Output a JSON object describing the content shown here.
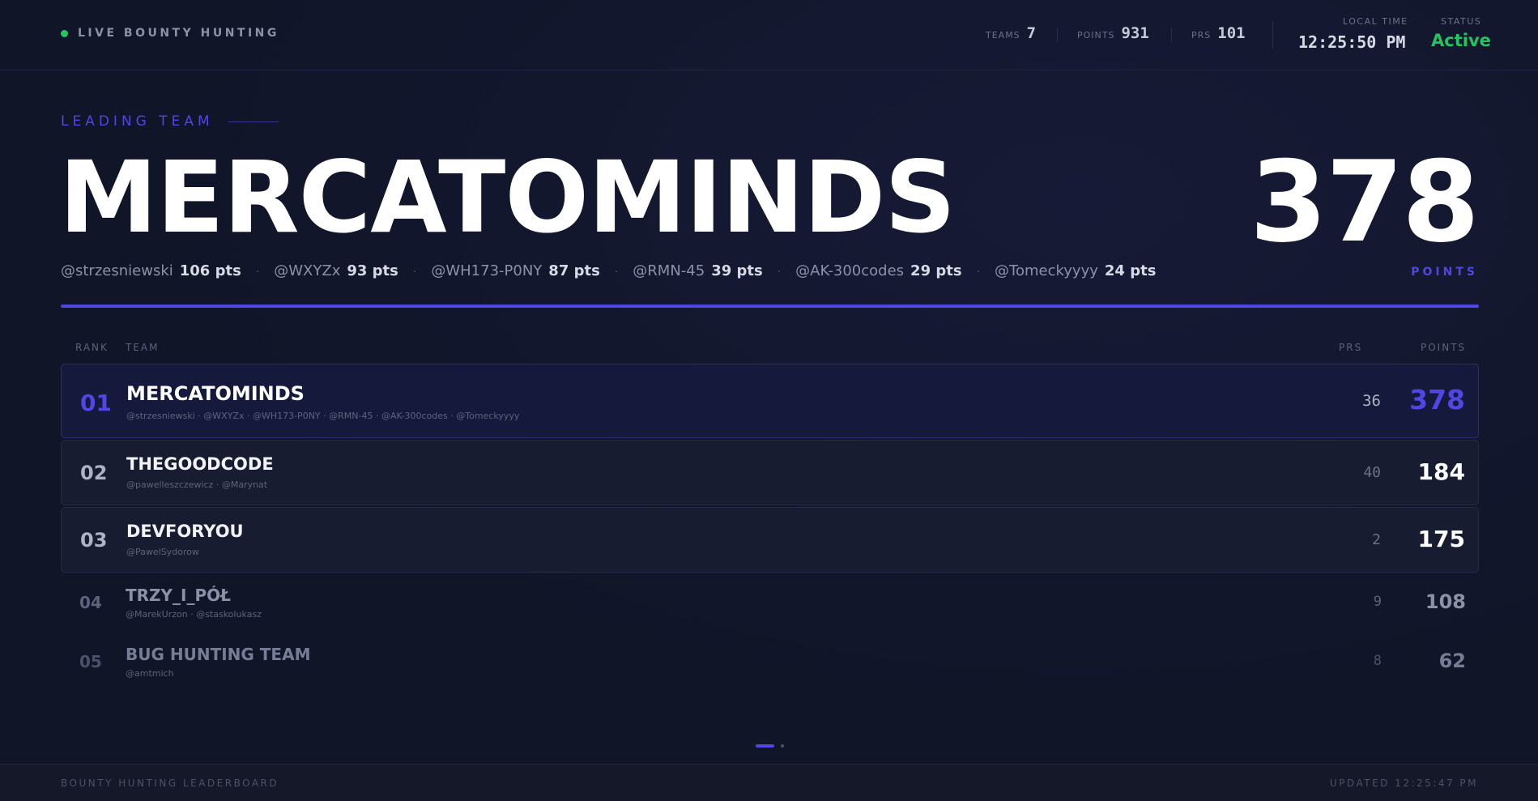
{
  "header": {
    "brand": "LIVE BOUNTY HUNTING",
    "stats": [
      {
        "label": "TEAMS",
        "value": "7"
      },
      {
        "label": "POINTS",
        "value": "931"
      },
      {
        "label": "PRS",
        "value": "101"
      }
    ],
    "local_time_label": "LOCAL TIME",
    "local_time": "12:25:50 PM",
    "status_label": "STATUS",
    "status": "Active"
  },
  "leading": {
    "label": "LEADING TEAM",
    "team": "MERCATOMINDS",
    "points": "378",
    "points_caption": "POINTS",
    "members": [
      {
        "handle": "@strzesniewski",
        "pts": "106 pts"
      },
      {
        "handle": "@WXYZx",
        "pts": "93 pts"
      },
      {
        "handle": "@WH173-P0NY",
        "pts": "87 pts"
      },
      {
        "handle": "@RMN-45",
        "pts": "39 pts"
      },
      {
        "handle": "@AK-300codes",
        "pts": "29 pts"
      },
      {
        "handle": "@Tomeckyyyy",
        "pts": "24 pts"
      }
    ],
    "separator": "·"
  },
  "table": {
    "headers": {
      "rank": "RANK",
      "team": "TEAM",
      "prs": "PRS",
      "points": "POINTS"
    },
    "rows": [
      {
        "rank": "01",
        "team": "MERCATOMINDS",
        "handles": "@strzesniewski · @WXYZx · @WH173-P0NY · @RMN-45 · @AK-300codes · @Tomeckyyyy",
        "prs": "36",
        "points": "378"
      },
      {
        "rank": "02",
        "team": "THEGOODCODE",
        "handles": "@pawelleszczewicz · @Marynat",
        "prs": "40",
        "points": "184"
      },
      {
        "rank": "03",
        "team": "DEVFORYOU",
        "handles": "@PawelSydorow",
        "prs": "2",
        "points": "175"
      },
      {
        "rank": "04",
        "team": "TRZY_I_PÓŁ",
        "handles": "@MarekUrzon · @staskolukasz",
        "prs": "9",
        "points": "108"
      },
      {
        "rank": "05",
        "team": "BUG HUNTING TEAM",
        "handles": "@amtmich",
        "prs": "8",
        "points": "62"
      }
    ]
  },
  "footer": {
    "left": "BOUNTY HUNTING LEADERBOARD",
    "right": "UPDATED 12:25:47 PM"
  },
  "colors": {
    "accent": "#4f46e5",
    "status_active": "#22c55e",
    "background": "#111528"
  }
}
